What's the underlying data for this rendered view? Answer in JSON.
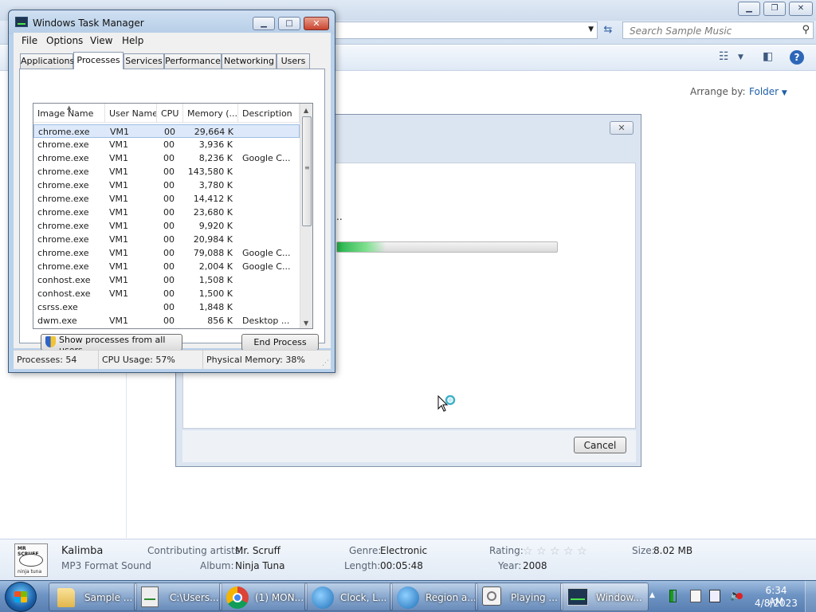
{
  "explorer": {
    "search_placeholder": "Search Sample Music",
    "arrange_label": "Arrange by:",
    "arrange_value": "Folder",
    "details": {
      "art_top": "MR SCRUFF",
      "art_bottom": "ninja tuna",
      "title": "Kalimba",
      "type": "MP3 Format Sound",
      "contributing_label": "Contributing artists:",
      "contributing_value": "Mr. Scruff",
      "album_label": "Album:",
      "album_value": "Ninja Tuna",
      "genre_label": "Genre:",
      "genre_value": "Electronic",
      "length_label": "Length:",
      "length_value": "00:05:48",
      "rating_label": "Rating:",
      "year_label": "Year:",
      "year_value": "2008",
      "size_label": "Size:",
      "size_value": "8.02 MB"
    }
  },
  "dialog": {
    "ellipsis": "..",
    "progress_fraction": 0.22,
    "cancel_label": "Cancel"
  },
  "taskmgr": {
    "title": "Windows Task Manager",
    "menu": [
      "File",
      "Options",
      "View",
      "Help"
    ],
    "tabs": [
      "Applications",
      "Processes",
      "Services",
      "Performance",
      "Networking",
      "Users"
    ],
    "active_tab": "Processes",
    "columns": [
      "Image Name",
      "User Name",
      "CPU",
      "Memory (...",
      "Description"
    ],
    "rows": [
      {
        "name": "chrome.exe",
        "user": "VM1",
        "cpu": "00",
        "mem": "29,664 K",
        "desc": ""
      },
      {
        "name": "chrome.exe",
        "user": "VM1",
        "cpu": "00",
        "mem": "3,936 K",
        "desc": ""
      },
      {
        "name": "chrome.exe",
        "user": "VM1",
        "cpu": "00",
        "mem": "8,236 K",
        "desc": "Google C..."
      },
      {
        "name": "chrome.exe",
        "user": "VM1",
        "cpu": "00",
        "mem": "143,580 K",
        "desc": ""
      },
      {
        "name": "chrome.exe",
        "user": "VM1",
        "cpu": "00",
        "mem": "3,780 K",
        "desc": ""
      },
      {
        "name": "chrome.exe",
        "user": "VM1",
        "cpu": "00",
        "mem": "14,412 K",
        "desc": ""
      },
      {
        "name": "chrome.exe",
        "user": "VM1",
        "cpu": "00",
        "mem": "23,680 K",
        "desc": ""
      },
      {
        "name": "chrome.exe",
        "user": "VM1",
        "cpu": "00",
        "mem": "9,920 K",
        "desc": ""
      },
      {
        "name": "chrome.exe",
        "user": "VM1",
        "cpu": "00",
        "mem": "20,984 K",
        "desc": ""
      },
      {
        "name": "chrome.exe",
        "user": "VM1",
        "cpu": "00",
        "mem": "79,088 K",
        "desc": "Google C..."
      },
      {
        "name": "chrome.exe",
        "user": "VM1",
        "cpu": "00",
        "mem": "2,004 K",
        "desc": "Google C..."
      },
      {
        "name": "conhost.exe",
        "user": "VM1",
        "cpu": "00",
        "mem": "1,508 K",
        "desc": ""
      },
      {
        "name": "conhost.exe",
        "user": "VM1",
        "cpu": "00",
        "mem": "1,500 K",
        "desc": ""
      },
      {
        "name": "csrss.exe",
        "user": "",
        "cpu": "00",
        "mem": "1,848 K",
        "desc": ""
      },
      {
        "name": "dwm.exe",
        "user": "VM1",
        "cpu": "00",
        "mem": "856 K",
        "desc": "Desktop ..."
      }
    ],
    "show_all_label": "Show processes from all users",
    "end_process_label": "End Process",
    "status": {
      "processes": "Processes: 54",
      "cpu": "CPU Usage: 57%",
      "memory": "Physical Memory: 38%"
    }
  },
  "taskbar": {
    "items": [
      {
        "label": "Sample ...",
        "icon": "folder-icon"
      },
      {
        "label": "C:\\Users...",
        "icon": "editor-icon"
      },
      {
        "label": "(1) MON...",
        "icon": "chrome-icon"
      },
      {
        "label": "Clock, L...",
        "icon": "globe-icon"
      },
      {
        "label": "Region a...",
        "icon": "globe-icon"
      },
      {
        "label": "Playing ...",
        "icon": "player-icon"
      },
      {
        "label": "Window...",
        "icon": "task-manager-icon"
      }
    ],
    "clock_time": "6:34 AM",
    "clock_date": "4/8/2023"
  }
}
